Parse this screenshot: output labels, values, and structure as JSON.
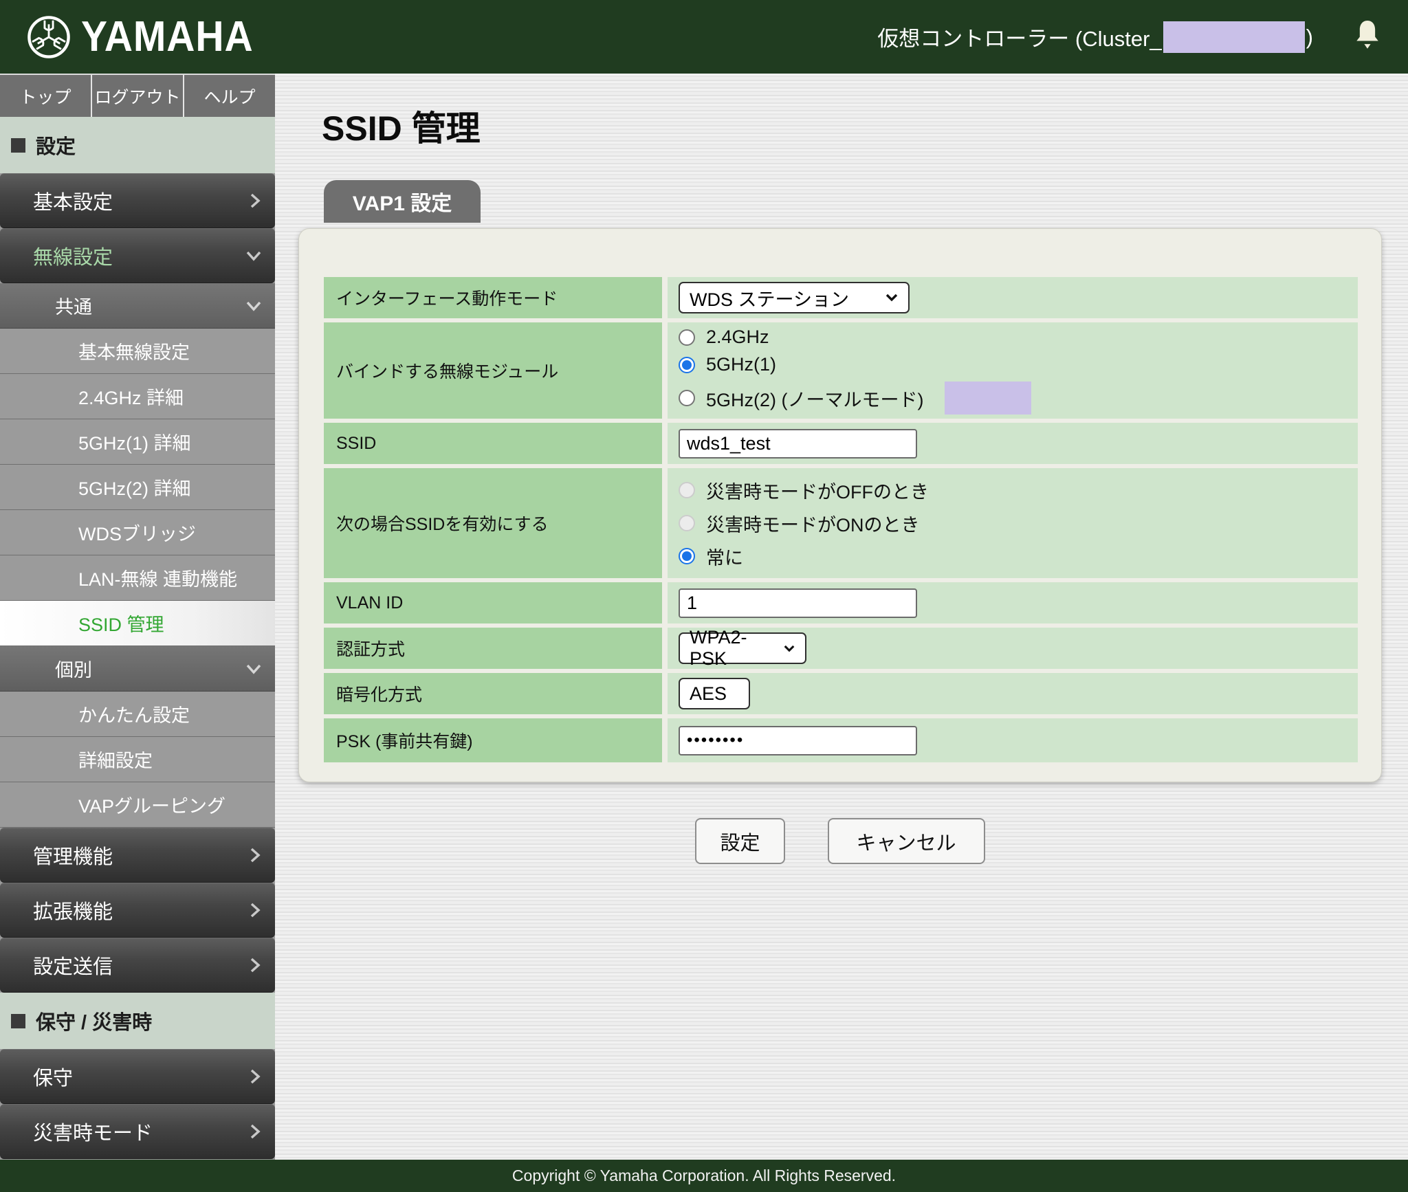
{
  "colors": {
    "brand_green": "#203c20",
    "nav_gray": "#6f6f6f",
    "section_header_bg": "#c9d5ca",
    "sidebar_active_text": "#33a733",
    "sidebar_parent_active_text": "#a9d9a9",
    "label_cell_green": "#a7d3a1",
    "value_cell_green": "#cfe5cc",
    "panel_bg": "#eeeee6",
    "radio_blue": "#1a73e8",
    "redaction_purple": "#c9c0e8"
  },
  "header": {
    "brand": "YAMAHA",
    "controller_label": "仮想コントローラー (Cluster_",
    "controller_suffix": ")"
  },
  "topnav": {
    "items": [
      {
        "label": "トップ"
      },
      {
        "label": "ログアウト"
      },
      {
        "label": "ヘルプ"
      }
    ]
  },
  "sidebar": {
    "items": [
      {
        "label": "設定",
        "type": "section"
      },
      {
        "label": "基本設定",
        "level": 1,
        "state": "collapsed"
      },
      {
        "label": "無線設定",
        "level": 1,
        "state": "expanded"
      },
      {
        "label": "共通",
        "level": 2,
        "state": "expanded"
      },
      {
        "label": "基本無線設定",
        "level": 3
      },
      {
        "label": "2.4GHz 詳細",
        "level": 3
      },
      {
        "label": "5GHz(1) 詳細",
        "level": 3
      },
      {
        "label": "5GHz(2) 詳細",
        "level": 3
      },
      {
        "label": "WDSブリッジ",
        "level": 3
      },
      {
        "label": "LAN-無線 連動機能",
        "level": 3
      },
      {
        "label": "SSID 管理",
        "level": 3,
        "selected": true
      },
      {
        "label": "個別",
        "level": 2,
        "state": "expanded"
      },
      {
        "label": "かんたん設定",
        "level": 3
      },
      {
        "label": "詳細設定",
        "level": 3
      },
      {
        "label": "VAPグルーピング",
        "level": 3
      },
      {
        "label": "管理機能",
        "level": 1,
        "state": "collapsed"
      },
      {
        "label": "拡張機能",
        "level": 1,
        "state": "collapsed"
      },
      {
        "label": "設定送信",
        "level": 1,
        "state": "collapsed"
      },
      {
        "label": "保守 / 災害時",
        "type": "section"
      },
      {
        "label": "保守",
        "level": 1,
        "state": "collapsed"
      },
      {
        "label": "災害時モード",
        "level": 1,
        "state": "collapsed"
      }
    ]
  },
  "main": {
    "page_title": "SSID 管理",
    "tab_label": "VAP1 設定",
    "form": {
      "rows": [
        {
          "label": "インターフェース動作モード",
          "control": "select",
          "value": "WDS ステーション"
        },
        {
          "label": "バインドする無線モジュール",
          "control": "radio-group",
          "options": [
            {
              "label": "2.4GHz",
              "checked": false
            },
            {
              "label": "5GHz(1)",
              "checked": true
            },
            {
              "label": "5GHz(2) (ノーマルモード)",
              "checked": false,
              "redacted": true
            }
          ]
        },
        {
          "label": "SSID",
          "control": "text",
          "value": "wds1_test"
        },
        {
          "label": "次の場合SSIDを有効にする",
          "control": "radio-group",
          "options": [
            {
              "label": "災害時モードがOFFのとき",
              "checked": false,
              "disabled": true
            },
            {
              "label": "災害時モードがONのとき",
              "checked": false,
              "disabled": true
            },
            {
              "label": "常に",
              "checked": true
            }
          ]
        },
        {
          "label": "VLAN ID",
          "control": "text",
          "value": "1"
        },
        {
          "label": "認証方式",
          "control": "select",
          "value": "WPA2-PSK"
        },
        {
          "label": "暗号化方式",
          "control": "select",
          "value": "AES"
        },
        {
          "label": "PSK (事前共有鍵)",
          "control": "password",
          "value": "••••••••"
        }
      ],
      "submit_label": "設定",
      "cancel_label": "キャンセル"
    }
  },
  "footer": {
    "copyright": "Copyright © Yamaha Corporation. All Rights Reserved."
  }
}
